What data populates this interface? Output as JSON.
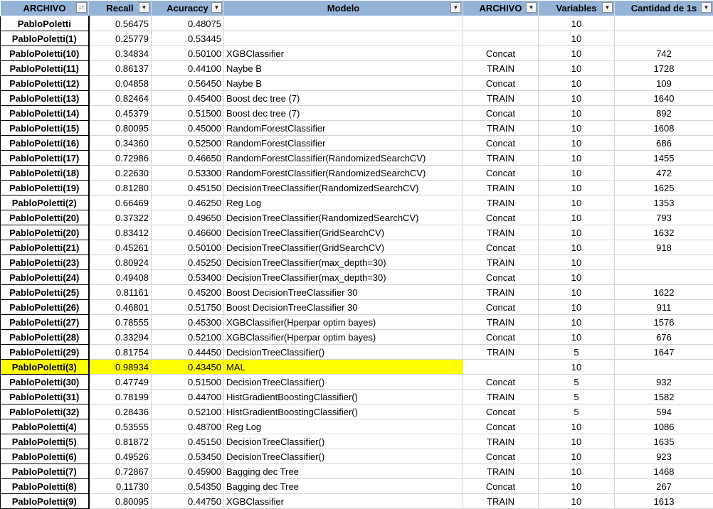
{
  "header": {
    "archivo": "ARCHIVO",
    "recall": "Recall",
    "accuracy": "Acuraccy",
    "modelo": "Modelo",
    "archivo2": "ARCHIVO",
    "variables": "Variables",
    "cantidad": "Cantidad de 1s",
    "sorted_filter_icon": "↓↑",
    "filter_icon": "▼"
  },
  "colors": {
    "header_bg": "#95b3d7",
    "highlight": "#ffff00"
  },
  "rows": [
    {
      "name": "PabloPoletti",
      "recall": "0.56475",
      "acc": "0.48075",
      "model": "",
      "archivo": "",
      "vars": "10",
      "count": ""
    },
    {
      "name": "PabloPoletti(1)",
      "recall": "0.25779",
      "acc": "0.53445",
      "model": "",
      "archivo": "",
      "vars": "10",
      "count": ""
    },
    {
      "name": "PabloPoletti(10)",
      "recall": "0.34834",
      "acc": "0.50100",
      "model": "XGBClassifier",
      "archivo": "Concat",
      "vars": "10",
      "count": "742"
    },
    {
      "name": "PabloPoletti(11)",
      "recall": "0.86137",
      "acc": "0.44100",
      "model": "Naybe B",
      "archivo": "TRAIN",
      "vars": "10",
      "count": "1728"
    },
    {
      "name": "PabloPoletti(12)",
      "recall": "0.04858",
      "acc": "0.56450",
      "model": "Naybe B",
      "archivo": "Concat",
      "vars": "10",
      "count": "109"
    },
    {
      "name": "PabloPoletti(13)",
      "recall": "0.82464",
      "acc": "0.45400",
      "model": "Boost dec tree (7)",
      "archivo": "TRAIN",
      "vars": "10",
      "count": "1640"
    },
    {
      "name": "PabloPoletti(14)",
      "recall": "0.45379",
      "acc": "0.51500",
      "model": "Boost dec tree (7)",
      "archivo": "Concat",
      "vars": "10",
      "count": "892"
    },
    {
      "name": "PabloPoletti(15)",
      "recall": "0.80095",
      "acc": "0.45000",
      "model": "RandomForestClassifier",
      "archivo": "TRAIN",
      "vars": "10",
      "count": "1608"
    },
    {
      "name": "PabloPoletti(16)",
      "recall": "0.34360",
      "acc": "0.52500",
      "model": "RandomForestClassifier",
      "archivo": "Concat",
      "vars": "10",
      "count": "686"
    },
    {
      "name": "PabloPoletti(17)",
      "recall": "0.72986",
      "acc": "0.46650",
      "model": "RandomForestClassifier(RandomizedSearchCV)",
      "archivo": "TRAIN",
      "vars": "10",
      "count": "1455"
    },
    {
      "name": "PabloPoletti(18)",
      "recall": "0.22630",
      "acc": "0.53300",
      "model": "RandomForestClassifier(RandomizedSearchCV)",
      "archivo": "Concat",
      "vars": "10",
      "count": "472"
    },
    {
      "name": "PabloPoletti(19)",
      "recall": "0.81280",
      "acc": "0.45150",
      "model": "DecisionTreeClassifier(RandomizedSearchCV)",
      "archivo": "TRAIN",
      "vars": "10",
      "count": "1625"
    },
    {
      "name": "PabloPoletti(2)",
      "recall": "0.66469",
      "acc": "0.46250",
      "model": "Reg Log",
      "archivo": "TRAIN",
      "vars": "10",
      "count": "1353"
    },
    {
      "name": "PabloPoletti(20)",
      "recall": "0.37322",
      "acc": "0.49650",
      "model": "DecisionTreeClassifier(RandomizedSearchCV)",
      "archivo": "Concat",
      "vars": "10",
      "count": "793"
    },
    {
      "name": "PabloPoletti(20)",
      "recall": "0.83412",
      "acc": "0.46600",
      "model": "DecisionTreeClassifier(GridSearchCV)",
      "archivo": "TRAIN",
      "vars": "10",
      "count": "1632"
    },
    {
      "name": "PabloPoletti(21)",
      "recall": "0.45261",
      "acc": "0.50100",
      "model": "DecisionTreeClassifier(GridSearchCV)",
      "archivo": "Concat",
      "vars": "10",
      "count": "918"
    },
    {
      "name": "PabloPoletti(23)",
      "recall": "0.80924",
      "acc": "0.45250",
      "model": "DecisionTreeClassifier(max_depth=30)",
      "archivo": "TRAIN",
      "vars": "10",
      "count": ""
    },
    {
      "name": "PabloPoletti(24)",
      "recall": "0.49408",
      "acc": "0.53400",
      "model": "DecisionTreeClassifier(max_depth=30)",
      "archivo": "Concat",
      "vars": "10",
      "count": ""
    },
    {
      "name": "PabloPoletti(25)",
      "recall": "0.81161",
      "acc": "0.45200",
      "model": "Boost DecisionTreeClassifier 30",
      "archivo": "TRAIN",
      "vars": "10",
      "count": "1622"
    },
    {
      "name": "PabloPoletti(26)",
      "recall": "0.46801",
      "acc": "0.51750",
      "model": "Boost DecisionTreeClassifier 30",
      "archivo": "Concat",
      "vars": "10",
      "count": "911"
    },
    {
      "name": "PabloPoletti(27)",
      "recall": "0.78555",
      "acc": "0.45300",
      "model": "XGBClassifier(Hperpar optim bayes)",
      "archivo": "TRAIN",
      "vars": "10",
      "count": "1576"
    },
    {
      "name": "PabloPoletti(28)",
      "recall": "0.33294",
      "acc": "0.52100",
      "model": "XGBClassifier(Hperpar optim bayes)",
      "archivo": "Concat",
      "vars": "10",
      "count": "676"
    },
    {
      "name": "PabloPoletti(29)",
      "recall": "0.81754",
      "acc": "0.44450",
      "model": "DecisionTreeClassifier()",
      "archivo": "TRAIN",
      "vars": "5",
      "count": "1647"
    },
    {
      "name": "PabloPoletti(3)",
      "recall": "0.98934",
      "acc": "0.43450",
      "model": "MAL",
      "archivo": "",
      "vars": "10",
      "count": "",
      "highlight": true
    },
    {
      "name": "PabloPoletti(30)",
      "recall": "0.47749",
      "acc": "0.51500",
      "model": "DecisionTreeClassifier()",
      "archivo": "Concat",
      "vars": "5",
      "count": "932"
    },
    {
      "name": "PabloPoletti(31)",
      "recall": "0.78199",
      "acc": "0.44700",
      "model": "HistGradientBoostingClassifier()",
      "archivo": "TRAIN",
      "vars": "5",
      "count": "1582"
    },
    {
      "name": "PabloPoletti(32)",
      "recall": "0.28436",
      "acc": "0.52100",
      "model": "HistGradientBoostingClassifier()",
      "archivo": "Concat",
      "vars": "5",
      "count": "594"
    },
    {
      "name": "PabloPoletti(4)",
      "recall": "0.53555",
      "acc": "0.48700",
      "model": "Reg Log",
      "archivo": "Concat",
      "vars": "10",
      "count": "1086"
    },
    {
      "name": "PabloPoletti(5)",
      "recall": "0.81872",
      "acc": "0.45150",
      "model": "DecisionTreeClassifier()",
      "archivo": "TRAIN",
      "vars": "10",
      "count": "1635"
    },
    {
      "name": "PabloPoletti(6)",
      "recall": "0.49526",
      "acc": "0.53450",
      "model": "DecisionTreeClassifier()",
      "archivo": "Concat",
      "vars": "10",
      "count": "923"
    },
    {
      "name": "PabloPoletti(7)",
      "recall": "0.72867",
      "acc": "0.45900",
      "model": "Bagging dec Tree",
      "archivo": "TRAIN",
      "vars": "10",
      "count": "1468"
    },
    {
      "name": "PabloPoletti(8)",
      "recall": "0.11730",
      "acc": "0.54350",
      "model": "Bagging dec Tree",
      "archivo": "Concat",
      "vars": "10",
      "count": "267"
    },
    {
      "name": "PabloPoletti(9)",
      "recall": "0.80095",
      "acc": "0.44750",
      "model": "XGBClassifier",
      "archivo": "TRAIN",
      "vars": "10",
      "count": "1613"
    }
  ]
}
